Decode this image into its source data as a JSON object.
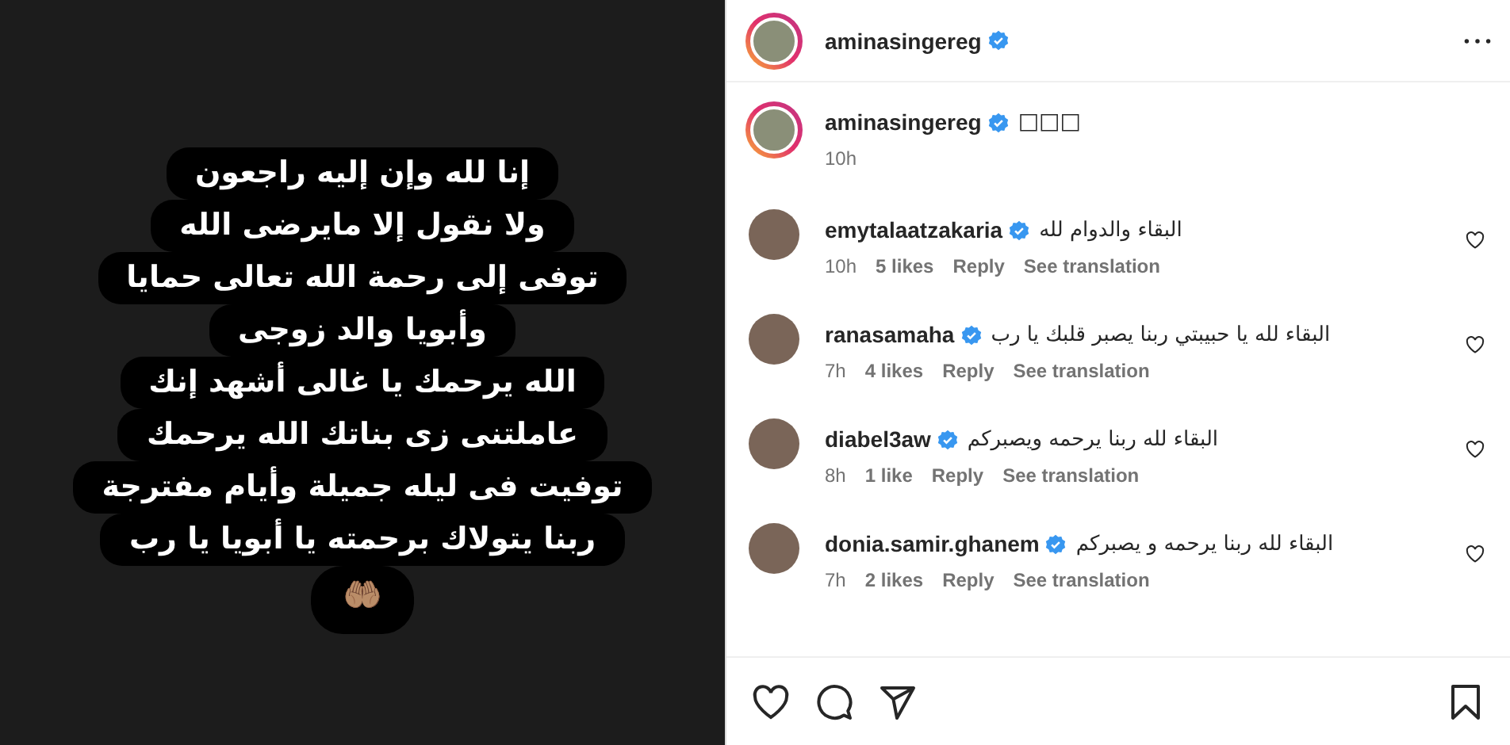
{
  "post_image": {
    "lines": [
      "إنا لله وإن إليه راجعون",
      "ولا نقول إلا مايرضى الله",
      "توفى إلى رحمة الله تعالى حمايا",
      "وأبويا والد زوجى",
      "الله يرحمك يا غالى أشهد إنك",
      "عاملتنى زى بناتك الله يرحمك",
      "توفيت فى ليله جميلة وأيام مفترجة",
      "ربنا يتولاك برحمته يا أبويا يا رب"
    ],
    "emoji": "🤲🏽"
  },
  "header": {
    "username": "aminasingereg",
    "verified": true
  },
  "caption": {
    "username": "aminasingereg",
    "verified": true,
    "text": "□□□",
    "time": "10h"
  },
  "comments": [
    {
      "username": "emytalaatzakaria",
      "verified": true,
      "text": "البقاء والدوام لله",
      "time": "10h",
      "likes": "5 likes",
      "reply": "Reply",
      "translate": "See translation",
      "liked": false
    },
    {
      "username": "ranasamaha",
      "verified": true,
      "text": "البقاء لله يا حبيبتي ربنا يصبر قلبك يا رب",
      "time": "7h",
      "likes": "4 likes",
      "reply": "Reply",
      "translate": "See translation",
      "liked": false
    },
    {
      "username": "diabel3aw",
      "verified": true,
      "text": "البقاء لله ربنا يرحمه ويصبركم",
      "time": "8h",
      "likes": "1 like",
      "reply": "Reply",
      "translate": "See translation",
      "liked": false
    },
    {
      "username": "donia.samir.ghanem",
      "verified": true,
      "text": "البقاء لله ربنا يرحمه و يصبركم",
      "time": "7h",
      "likes": "2 likes",
      "reply": "Reply",
      "translate": "See translation",
      "liked": false
    }
  ],
  "actions": {
    "liked": false,
    "saved": false
  }
}
